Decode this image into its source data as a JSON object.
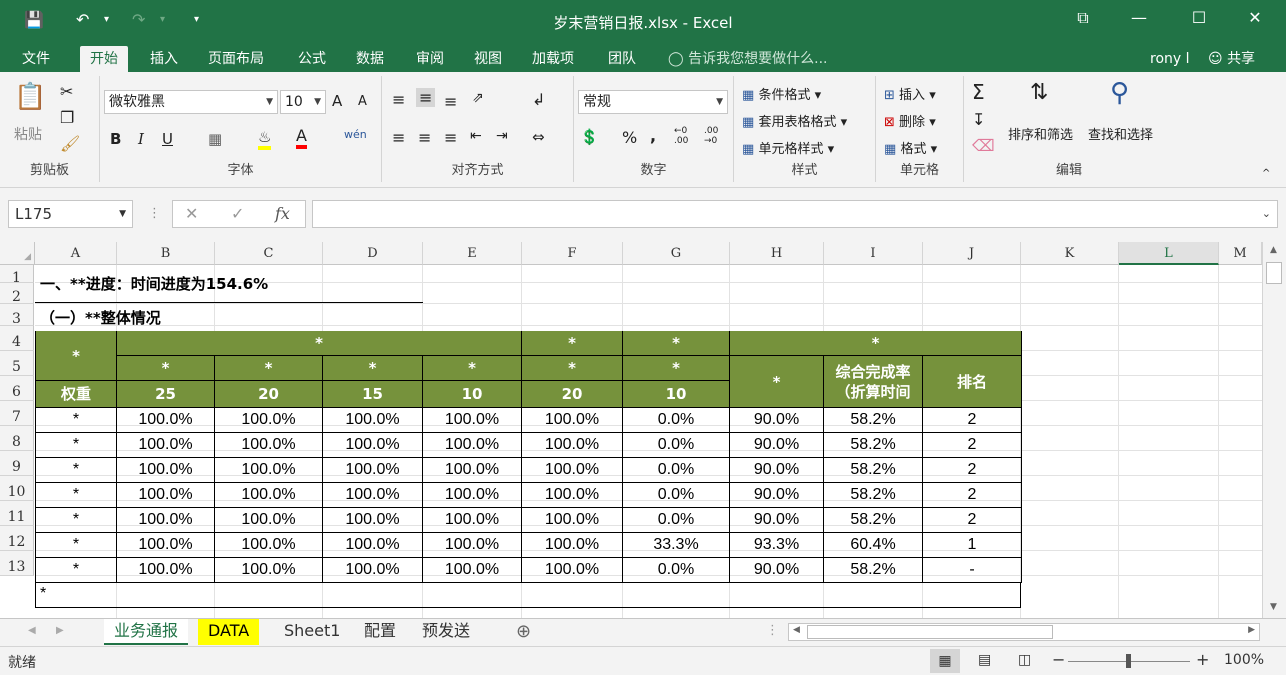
{
  "window": {
    "title": "岁末营销日报.xlsx - Excel",
    "quick_access": {
      "save_icon": "save-icon",
      "undo_icon": "undo-icon",
      "redo_icon": "redo-icon",
      "customize": "▾"
    },
    "controls": {
      "restore_ribbon": "ribbon-display-icon",
      "minimize": "—",
      "maximize": "☐",
      "close": "✕"
    }
  },
  "menu": {
    "tabs": [
      "文件",
      "开始",
      "插入",
      "页面布局",
      "公式",
      "数据",
      "审阅",
      "视图",
      "加载项",
      "团队"
    ],
    "active_tab": "开始",
    "tell_me": "告诉我您想要做什么...",
    "user": "rony l",
    "share": "共享"
  },
  "ribbon": {
    "clipboard": {
      "paste": "粘贴",
      "label": "剪贴板"
    },
    "font": {
      "name": "微软雅黑",
      "size": "10",
      "label": "字体",
      "bold": "B",
      "italic": "I",
      "underline": "U",
      "grow": "A",
      "shrink": "A",
      "wen": "wén"
    },
    "alignment": {
      "label": "对齐方式"
    },
    "number": {
      "format": "常规",
      "percent": "%",
      "comma": ",",
      "inc": "←0 .00",
      "dec": ".00 →0",
      "label": "数字"
    },
    "styles": {
      "conditional": "条件格式",
      "table": "套用表格格式",
      "cell": "单元格样式",
      "label": "样式"
    },
    "cells": {
      "insert": "插入",
      "delete": "删除",
      "format": "格式",
      "label": "单元格"
    },
    "editing": {
      "sort": "排序和筛选",
      "find": "查找和选择",
      "label": "编辑"
    }
  },
  "formula_bar": {
    "name_box": "L175",
    "fx": "fx",
    "cancel": "✕",
    "enter": "✓",
    "content": ""
  },
  "sheet": {
    "columns": [
      "A",
      "B",
      "C",
      "D",
      "E",
      "F",
      "G",
      "H",
      "I",
      "J",
      "K",
      "L",
      "M"
    ],
    "selected_column": "L",
    "rows": [
      "1",
      "2",
      "3",
      "4",
      "5",
      "6",
      "7",
      "8",
      "9",
      "10",
      "11",
      "12",
      "13"
    ],
    "title1": "一、**进度：时间进度为154.6%",
    "title2": "（一）**整体情况",
    "header": {
      "a34": "*",
      "b3": "*",
      "f3": "*",
      "g3": "*",
      "h3": "*",
      "b4": "*",
      "c4": "*",
      "d4": "*",
      "e4": "*",
      "f4": "*",
      "g4": "*",
      "h45": "*",
      "i45": "综合完成率（折算时间",
      "j45": "排名",
      "a5": "权重",
      "b5": "25",
      "c5": "20",
      "d5": "15",
      "e5": "10",
      "f5": "20",
      "g5": "10"
    },
    "data_rows": [
      [
        "*",
        "100.0%",
        "100.0%",
        "100.0%",
        "100.0%",
        "100.0%",
        "0.0%",
        "90.0%",
        "58.2%",
        "2"
      ],
      [
        "*",
        "100.0%",
        "100.0%",
        "100.0%",
        "100.0%",
        "100.0%",
        "0.0%",
        "90.0%",
        "58.2%",
        "2"
      ],
      [
        "*",
        "100.0%",
        "100.0%",
        "100.0%",
        "100.0%",
        "100.0%",
        "0.0%",
        "90.0%",
        "58.2%",
        "2"
      ],
      [
        "*",
        "100.0%",
        "100.0%",
        "100.0%",
        "100.0%",
        "100.0%",
        "0.0%",
        "90.0%",
        "58.2%",
        "2"
      ],
      [
        "*",
        "100.0%",
        "100.0%",
        "100.0%",
        "100.0%",
        "100.0%",
        "0.0%",
        "90.0%",
        "58.2%",
        "2"
      ],
      [
        "*",
        "100.0%",
        "100.0%",
        "100.0%",
        "100.0%",
        "100.0%",
        "33.3%",
        "93.3%",
        "60.4%",
        "1"
      ],
      [
        "*",
        "100.0%",
        "100.0%",
        "100.0%",
        "100.0%",
        "100.0%",
        "0.0%",
        "90.0%",
        "58.2%",
        "-"
      ]
    ],
    "note": "*",
    "header_color": "#76923c"
  },
  "sheet_tabs": [
    "业务通报",
    "DATA",
    "Sheet1",
    "配置",
    "预发送"
  ],
  "active_sheet": "业务通报",
  "highlight_sheet": "DATA",
  "status": {
    "ready": "就绪",
    "zoom": "100%"
  }
}
